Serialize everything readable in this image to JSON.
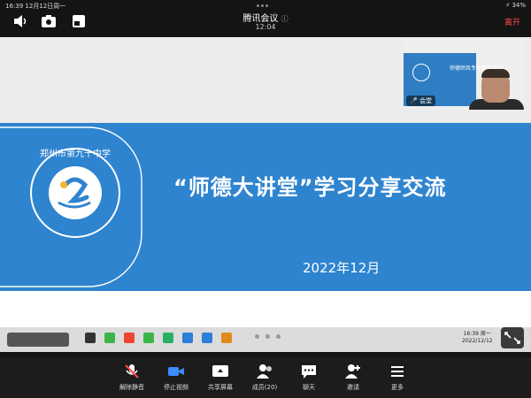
{
  "status_bar": {
    "time": "16:39",
    "date": "12月12日周一",
    "battery": "34%"
  },
  "header": {
    "title": "腾讯会议",
    "meeting_time": "12:04",
    "leave_label": "离开"
  },
  "slide": {
    "title": "“师德大讲堂”学习分享交流",
    "date": "2022年12月",
    "school_name": "郑州市第九十中学"
  },
  "video_tile": {
    "name": "会堂",
    "slide_text": "师德师风专项教育活动"
  },
  "taskbar": {
    "clock_time": "16:39 周一",
    "clock_date": "2022/12/12"
  },
  "toolbar": {
    "items": [
      {
        "label": "解除静音",
        "icon": "mic-off-icon",
        "color": "#ffffff"
      },
      {
        "label": "停止视频",
        "icon": "video-icon",
        "color": "#3d8bff"
      },
      {
        "label": "共享屏幕",
        "icon": "share-screen-icon",
        "color": "#ffffff"
      },
      {
        "label": "成员(20)",
        "icon": "members-icon",
        "color": "#ffffff"
      },
      {
        "label": "聊天",
        "icon": "chat-icon",
        "color": "#ffffff"
      },
      {
        "label": "邀请",
        "icon": "invite-icon",
        "color": "#ffffff"
      },
      {
        "label": "更多",
        "icon": "more-icon",
        "color": "#ffffff"
      }
    ]
  },
  "colors": {
    "slide_blue": "#2e84cf",
    "leave_red": "#ff4a4a",
    "active_blue": "#3d8bff"
  }
}
